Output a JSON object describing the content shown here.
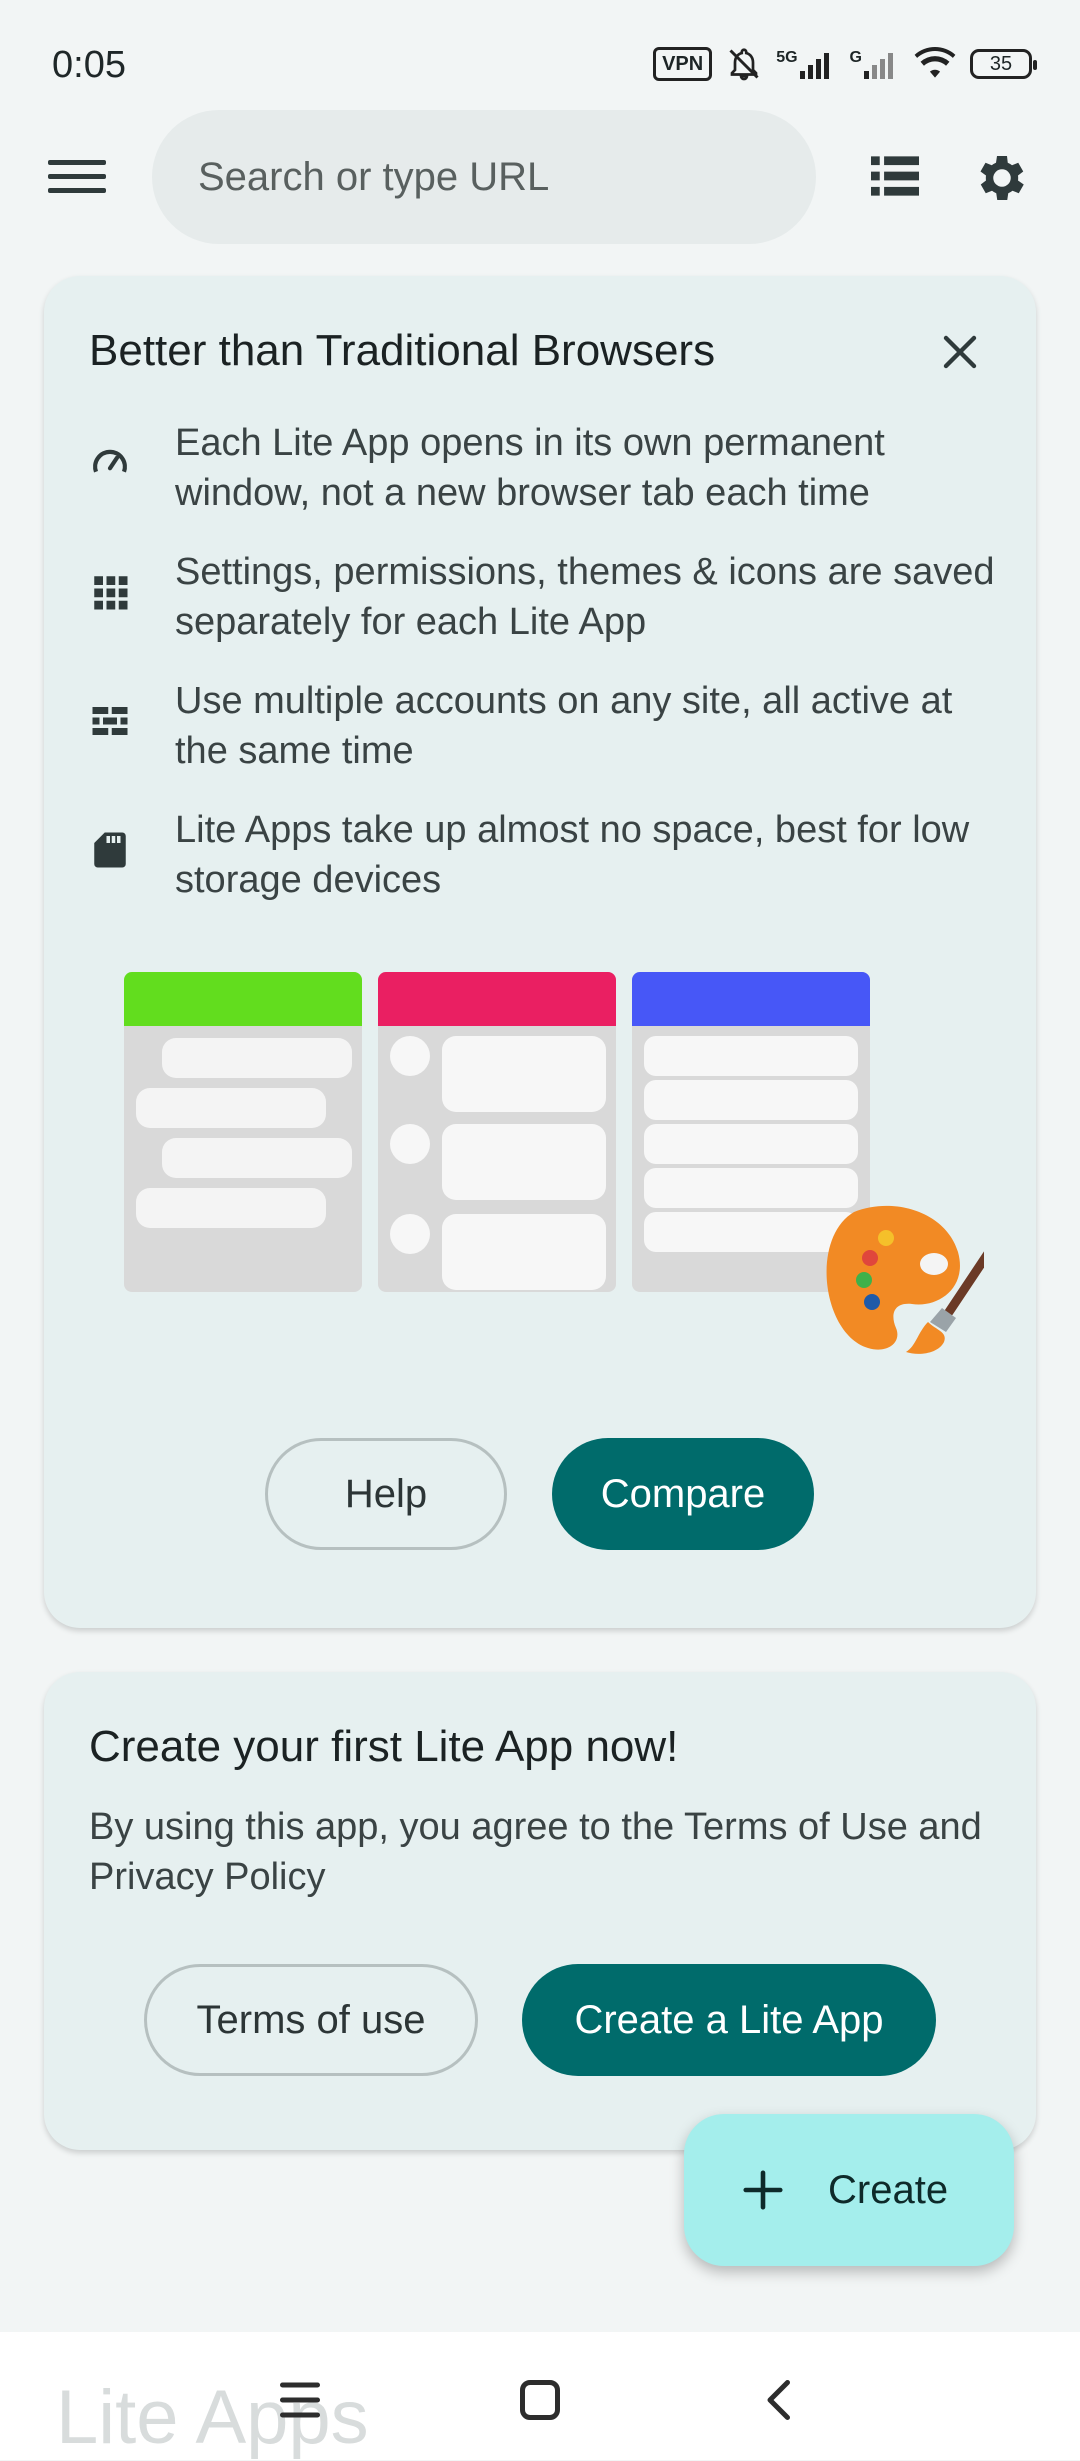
{
  "status_bar": {
    "time": "0:05",
    "vpn": "VPN",
    "network1": "5G",
    "network2": "G",
    "battery": "35"
  },
  "search": {
    "placeholder": "Search or type URL"
  },
  "icons": {
    "menu": "menu-icon",
    "tabs": "tabs-list-icon",
    "settings": "gear-icon",
    "close": "close-icon",
    "speed": "speedometer-icon",
    "grid": "grid-icon",
    "accounts": "wall-icon",
    "storage": "sd-card-icon",
    "add": "plus-icon"
  },
  "info_card": {
    "title": "Better than Traditional Browsers",
    "features": [
      "Each Lite App opens in its own permanent window, not a new browser tab each time",
      "Settings, permissions, themes & icons are saved separately for each Lite App",
      "Use multiple accounts on any site, all active at the same time",
      "Lite Apps take up almost no space, best for low storage devices"
    ],
    "help_label": "Help",
    "compare_label": "Compare",
    "illustration_colors": [
      "#62dd1e",
      "#ea1f62",
      "#4757f7"
    ]
  },
  "create_card": {
    "title": "Create your first Lite App now!",
    "text": "By using this app, you agree to the Terms of Use and Privacy Policy",
    "terms_label": "Terms of use",
    "create_label": "Create a Lite App"
  },
  "fab": {
    "label": "Create"
  },
  "watermark": "Lite Apps",
  "colors": {
    "accent": "#006b6b",
    "fab": "#a4eeec",
    "card": "#e6f0f0"
  }
}
